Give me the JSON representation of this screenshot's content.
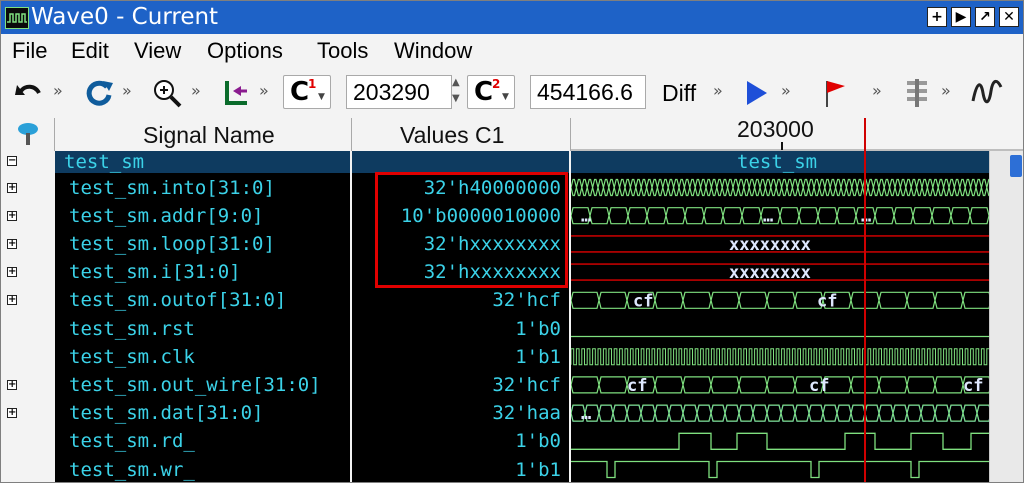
{
  "window": {
    "title": "Wave0 - Current",
    "buttons": [
      "+",
      "▶",
      "↗",
      "✕"
    ]
  },
  "menu": [
    "File",
    "Edit",
    "View",
    "Options",
    "Tools",
    "Window"
  ],
  "toolbar": {
    "cursor1_label": "C",
    "cursor1_index": "1",
    "cursor1_value": "203290",
    "cursor2_label": "C",
    "cursor2_index": "2",
    "cursor2_value": "454166.6",
    "diff_label": "Diff",
    "chevron": "»"
  },
  "columns": {
    "name": "Signal Name",
    "values": "Values C1",
    "time": "203000"
  },
  "group": {
    "name": "test_sm",
    "wave_label": "test_sm"
  },
  "signals": [
    {
      "name": "test_sm.into[31:0]",
      "value": "32'h40000000",
      "expandable": true
    },
    {
      "name": "test_sm.addr[9:0]",
      "value": "10'b0000010000",
      "expandable": true
    },
    {
      "name": "test_sm.loop[31:0]",
      "value": "32'hxxxxxxxx",
      "expandable": true
    },
    {
      "name": "test_sm.i[31:0]",
      "value": "32'hxxxxxxxx",
      "expandable": true
    },
    {
      "name": "test_sm.outof[31:0]",
      "value": "32'hcf",
      "expandable": true
    },
    {
      "name": "test_sm.rst",
      "value": "1'b0",
      "expandable": false
    },
    {
      "name": "test_sm.clk",
      "value": "1'b1",
      "expandable": false
    },
    {
      "name": "test_sm.out_wire[31:0]",
      "value": "32'hcf",
      "expandable": true
    },
    {
      "name": "test_sm.dat[31:0]",
      "value": "32'haa",
      "expandable": true
    },
    {
      "name": "test_sm.rd_",
      "value": "1'b0",
      "expandable": false
    },
    {
      "name": "test_sm.wr_",
      "value": "1'b1",
      "expandable": false
    }
  ],
  "wave_labels": {
    "addr": "…",
    "loop": "xxxxxxxx",
    "i": "xxxxxxxx",
    "outof": "cf",
    "out_wire": "cf",
    "dat": "…"
  },
  "colors": {
    "signal_text": "#3bd2e8",
    "wave_green": "#7fe07f",
    "wave_red": "#e00000",
    "wave_blue": "#1e40ff",
    "titlebar": "#1e62c7",
    "group_row": "#0e3b60",
    "highlight_box": "#e00000"
  }
}
